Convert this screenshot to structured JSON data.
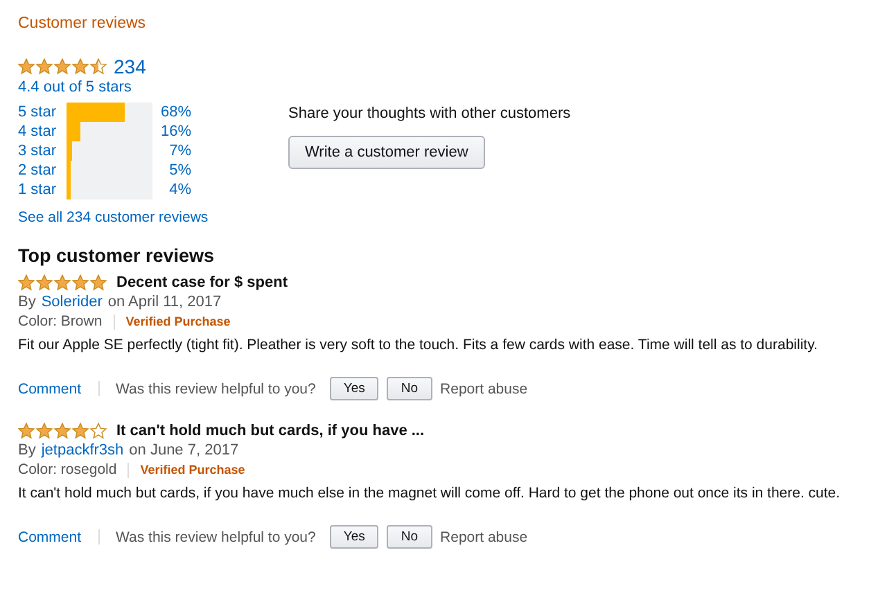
{
  "header": "Customer reviews",
  "summary": {
    "stars": 4.5,
    "count": "234",
    "average": "4.4 out of 5 stars"
  },
  "histogram": [
    {
      "label": "5 star",
      "level": 0.68,
      "percent": "68%"
    },
    {
      "label": "4 star",
      "level": 0.16,
      "percent": "16%"
    },
    {
      "label": "3 star",
      "level": 0.07,
      "percent": "7%"
    },
    {
      "label": "2 star",
      "level": 0.05,
      "percent": "5%"
    },
    {
      "label": "1 star",
      "level": 0.04,
      "percent": "4%"
    }
  ],
  "see_all": "See all 234 customer reviews",
  "share": {
    "text": "Share your thoughts with other customers",
    "button": "Write a customer review"
  },
  "reviews_title": "Top customer reviews",
  "reviews": [
    {
      "stars": 5,
      "title": "Decent case for $ spent",
      "by": "By",
      "author": "Solerider",
      "date": "on April 11, 2017",
      "variant": "Color: Brown",
      "badge": "Verified Purchase",
      "body": "Fit our Apple SE perfectly (tight fit). Pleather is very soft to the touch. Fits a few cards with ease. Time will tell as to durability.",
      "comment": "Comment",
      "helpful": "Was this review helpful to you?",
      "yes": "Yes",
      "no": "No",
      "report": "Report abuse"
    },
    {
      "stars": 4,
      "title": "It can't hold much but cards, if you have ...",
      "by": "By",
      "author": "jetpackfr3sh",
      "date": "on June 7, 2017",
      "variant": "Color: rosegold",
      "badge": "Verified Purchase",
      "body": "It can't hold much but cards, if you have much else in the magnet will come off. Hard to get the phone out once its in there. cute.",
      "comment": "Comment",
      "helpful": "Was this review helpful to you?",
      "yes": "Yes",
      "no": "No",
      "report": "Report abuse"
    }
  ]
}
